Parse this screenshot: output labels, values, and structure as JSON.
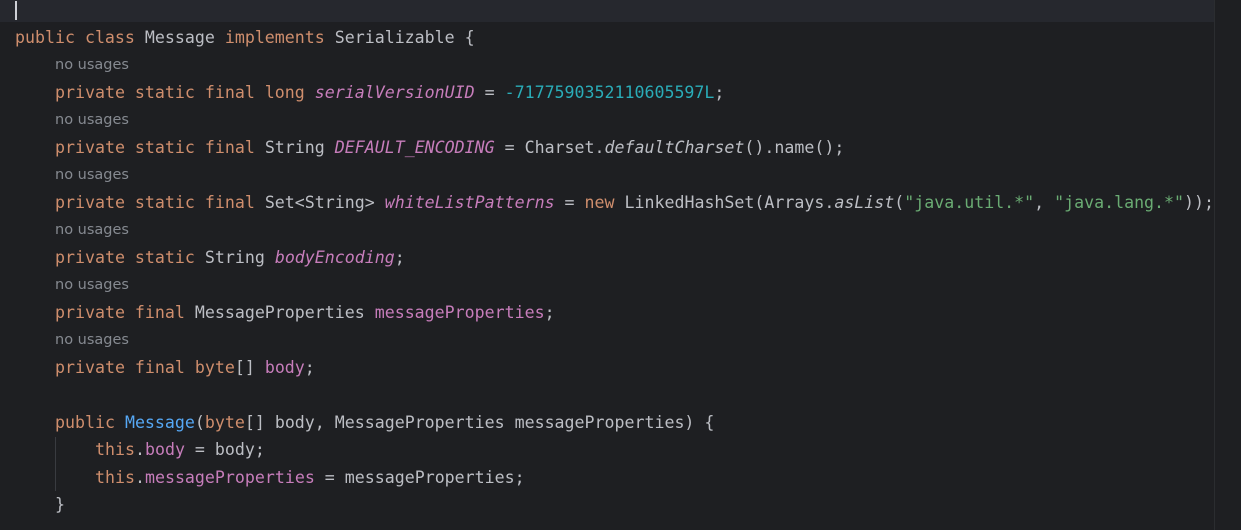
{
  "editor": {
    "usage_hint": "no usages",
    "lines": {
      "class_decl": {
        "kw_public": "public",
        "kw_class": "class",
        "name": "Message",
        "kw_implements": "implements",
        "iface": "Serializable",
        "brace": " {"
      },
      "l1": {
        "kw": "private static final long",
        "field": "serialVersionUID",
        "eq": " = ",
        "value": "-7177590352110605597L",
        "end": ";"
      },
      "l2": {
        "kw": "private static final",
        "type": "String",
        "field": "DEFAULT_ENCODING",
        "eq": " = Charset.",
        "method": "defaultCharset",
        "end": "().name();"
      },
      "l3": {
        "kw": "private static final",
        "type": "Set<String>",
        "field": "whiteListPatterns",
        "eq": " = ",
        "kw_new": "new",
        "ctor": " LinkedHashSet(Arrays.",
        "method": "asList",
        "open": "(",
        "str1": "\"java.util.*\"",
        "comma": ", ",
        "str2": "\"java.lang.*\"",
        "end": "));"
      },
      "l4": {
        "kw": "private static",
        "type": "String",
        "field": "bodyEncoding",
        "end": ";"
      },
      "l5": {
        "kw": "private final",
        "type": "MessageProperties",
        "field": "messageProperties",
        "end": ";"
      },
      "l6": {
        "kw": "private final",
        "type": "byte",
        "brackets": "[]",
        "field": "body",
        "end": ";"
      },
      "ctor_decl": {
        "kw": "public",
        "name": "Message",
        "open": "(",
        "kw_byte": "byte",
        "params": "[] body, MessageProperties messageProperties) {"
      },
      "b1": {
        "kw_this": "this",
        "dot": ".",
        "field": "body",
        "rest": " = body;"
      },
      "b2": {
        "kw_this": "this",
        "dot": ".",
        "field": "messageProperties",
        "rest": " = messageProperties;"
      },
      "close": "}"
    }
  }
}
